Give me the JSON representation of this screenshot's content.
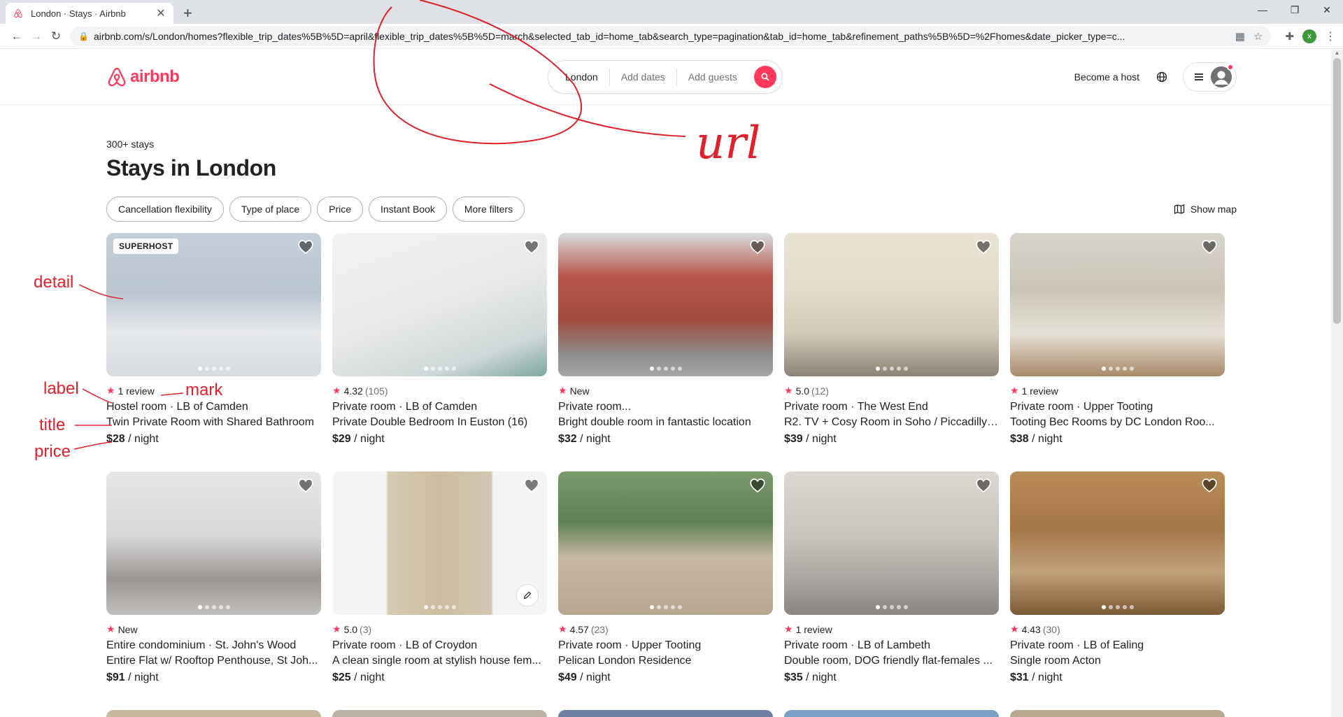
{
  "browser": {
    "tab_title": "London · Stays · Airbnb",
    "new_tab": "+",
    "url": "airbnb.com/s/London/homes?flexible_trip_dates%5B%5D=april&flexible_trip_dates%5B%5D=march&selected_tab_id=home_tab&search_type=pagination&tab_id=home_tab&refinement_paths%5B%5D=%2Fhomes&date_picker_type=c...",
    "profile_initial": "x"
  },
  "header": {
    "logo_text": "airbnb",
    "search": {
      "location": "London",
      "dates": "Add dates",
      "guests": "Add guests"
    },
    "become_host": "Become a host"
  },
  "main": {
    "stay_count": "300+ stays",
    "title": "Stays in London",
    "filters": [
      "Cancellation flexibility",
      "Type of place",
      "Price",
      "Instant Book",
      "More filters"
    ],
    "show_map": "Show map"
  },
  "listings": [
    {
      "badge": "SUPERHOST",
      "rating": "",
      "reviews": "1 review",
      "type": "Hostel room · LB of Camden",
      "title": "Twin Private Room with Shared Bathroom",
      "price": "$28",
      "per": "/ night"
    },
    {
      "badge": "",
      "rating": "4.32",
      "reviews": "(105)",
      "type": "Private room · LB of Camden",
      "title": "Private Double Bedroom In Euston (16)",
      "price": "$29",
      "per": "/ night"
    },
    {
      "badge": "",
      "rating": "",
      "reviews": "New",
      "type": "Private room...",
      "title": "Bright double room in fantastic location",
      "price": "$32",
      "per": "/ night"
    },
    {
      "badge": "",
      "rating": "5.0",
      "reviews": "(12)",
      "type": "Private room · The West End",
      "title": "R2. TV + Cosy Room in Soho / Piccadilly ...",
      "price": "$39",
      "per": "/ night"
    },
    {
      "badge": "",
      "rating": "",
      "reviews": "1 review",
      "type": "Private room · Upper Tooting",
      "title": "Tooting Bec Rooms by DC London Roo...",
      "price": "$38",
      "per": "/ night"
    },
    {
      "badge": "",
      "rating": "",
      "reviews": "New",
      "type": "Entire condominium · St. John's Wood",
      "title": "Entire Flat w/ Rooftop Penthouse, St Joh...",
      "price": "$91",
      "per": "/ night"
    },
    {
      "badge": "",
      "rating": "5.0",
      "reviews": "(3)",
      "type": "Private room · LB of Croydon",
      "title": "A clean single room at stylish house fem...",
      "price": "$25",
      "per": "/ night"
    },
    {
      "badge": "",
      "rating": "4.57",
      "reviews": "(23)",
      "type": "Private room · Upper Tooting",
      "title": "Pelican London Residence",
      "price": "$49",
      "per": "/ night"
    },
    {
      "badge": "",
      "rating": "",
      "reviews": "1 review",
      "type": "Private room · LB of Lambeth",
      "title": "Double room, DOG friendly flat-females ...",
      "price": "$35",
      "per": "/ night"
    },
    {
      "badge": "",
      "rating": "4.43",
      "reviews": "(30)",
      "type": "Private room · LB of Ealing",
      "title": "Single room Acton",
      "price": "$31",
      "per": "/ night"
    }
  ],
  "annotations": {
    "detail": "detail",
    "label": "label",
    "mark": "mark",
    "title": "title",
    "price": "price",
    "url": "url"
  },
  "colors": {
    "brand": "#ff385c",
    "annotation": "#e0202a"
  }
}
